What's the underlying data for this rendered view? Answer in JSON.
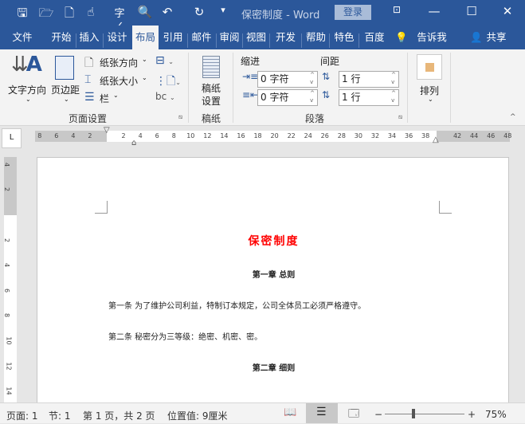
{
  "titlebar": {
    "doc_title": "保密制度  -  Word",
    "login": "登录",
    "quick_access": [
      "save-icon",
      "open-icon",
      "new-icon",
      "touch-mode-icon",
      "spelling-icon",
      "print-preview-icon",
      "undo-icon",
      "redo-icon",
      "customize-icon"
    ]
  },
  "tabs": [
    "文件",
    "开始",
    "插入",
    "设计",
    "布局",
    "引用",
    "邮件",
    "审阅",
    "视图",
    "开发工",
    "帮助",
    "特色功",
    "百度网"
  ],
  "tell_me": "告诉我",
  "share": "共享",
  "ribbon": {
    "page_setup": {
      "label": "页面设置",
      "text_direction": "文字方向",
      "margins": "页边距",
      "orientation": "纸张方向",
      "size": "纸张大小",
      "columns": "栏"
    },
    "manuscript": {
      "label": "稿纸",
      "button": "稿纸\n设置",
      "line1": "稿纸",
      "line2": "设置"
    },
    "paragraph": {
      "label": "段落",
      "indent": "缩进",
      "spacing": "间距",
      "indent_left": "0 字符",
      "indent_right": "0 字符",
      "spacing_before": "1 行",
      "spacing_after": "1 行"
    },
    "arrange": {
      "label": "排列"
    }
  },
  "ruler": {
    "left": [
      "8",
      "6",
      "4",
      "2"
    ],
    "main": [
      "2",
      "4",
      "6",
      "8",
      "10",
      "12",
      "14",
      "16",
      "18",
      "20",
      "22",
      "24",
      "26",
      "28",
      "30",
      "32",
      "34",
      "36",
      "38"
    ],
    "right": [
      "42",
      "44",
      "46",
      "48"
    ],
    "vertical_top": [
      "4",
      "2"
    ],
    "vertical": [
      "2",
      "4",
      "6",
      "8",
      "10",
      "12",
      "14"
    ],
    "tab_selector": "L"
  },
  "document": {
    "title": "保密制度",
    "chapter1": "第一章  总则",
    "article1": "第一条  为了维护公司利益，特制订本规定，公司全体员工必须严格遵守。",
    "article2": "第二条  秘密分为三等级：绝密、机密、密。",
    "chapter2": "第二章  细则"
  },
  "status": {
    "page": "页面: 1",
    "section": "节: 1",
    "pages": "第 1 页，共 2 页",
    "position": "位置值: 9厘米",
    "zoom": "75%",
    "zoom_percent": 75
  }
}
